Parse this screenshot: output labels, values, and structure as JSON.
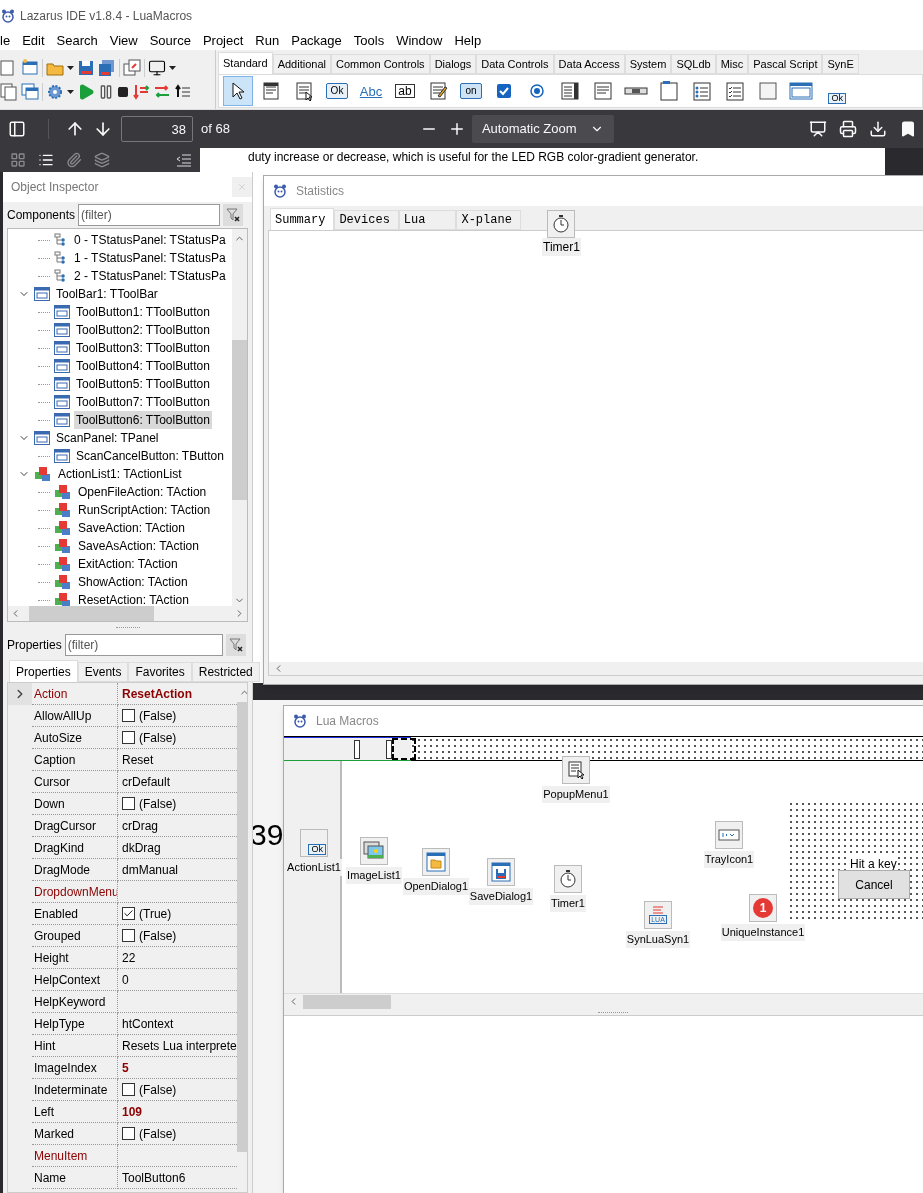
{
  "title_bar": {
    "title": "Lazarus IDE v1.8.4 - LuaMacros"
  },
  "menu": [
    "le",
    "Edit",
    "Search",
    "View",
    "Source",
    "Project",
    "Run",
    "Package",
    "Tools",
    "Window",
    "Help"
  ],
  "palette": {
    "tabs": [
      {
        "label": "Standard",
        "selected": true
      },
      {
        "label": "Additional",
        "selected": false
      },
      {
        "label": "Common Controls",
        "selected": false
      },
      {
        "label": "Dialogs",
        "selected": false
      },
      {
        "label": "Data Controls",
        "selected": false
      },
      {
        "label": "Data Access",
        "selected": false
      },
      {
        "label": "System",
        "selected": false
      },
      {
        "label": "SQLdb",
        "selected": false
      },
      {
        "label": "Misc",
        "selected": false
      },
      {
        "label": "Pascal Script",
        "selected": false
      },
      {
        "label": "SynE",
        "selected": false
      }
    ],
    "icons": [
      {
        "kind": "pointer",
        "selected": true
      },
      {
        "kind": "mainmenu",
        "selected": false
      },
      {
        "kind": "popupmenu",
        "selected": false
      },
      {
        "kind": "button",
        "text": "Ok",
        "selected": false
      },
      {
        "kind": "label",
        "text": "Abc",
        "selected": false
      },
      {
        "kind": "edit",
        "text": "ab",
        "selected": false
      },
      {
        "kind": "memo",
        "selected": false
      },
      {
        "kind": "toggle",
        "text": "on",
        "selected": false
      },
      {
        "kind": "checkbox",
        "selected": false
      },
      {
        "kind": "radio",
        "selected": false
      },
      {
        "kind": "listbox",
        "selected": false
      },
      {
        "kind": "combobox",
        "selected": false
      },
      {
        "kind": "scrollbar",
        "selected": false
      },
      {
        "kind": "groupbox",
        "selected": false
      },
      {
        "kind": "radiogroup",
        "selected": false
      },
      {
        "kind": "checkgroup",
        "selected": false
      },
      {
        "kind": "panel",
        "selected": false
      },
      {
        "kind": "frame",
        "selected": false
      },
      {
        "kind": "actionlist",
        "text": "Ok",
        "selected": false
      }
    ]
  },
  "pdf_viewer": {
    "page": "38",
    "page_count": "of 68",
    "zoom": "Automatic Zoom",
    "sidebar_views": [
      {
        "kind": "thumbnails",
        "selected": false
      },
      {
        "kind": "outline",
        "selected": true
      },
      {
        "kind": "attachments",
        "selected": false
      },
      {
        "kind": "layers",
        "selected": false
      }
    ],
    "page_text": "duty increase or decrease, which is useful for the LED RGB color-gradient generator.",
    "page_number": "39"
  },
  "object_inspector": {
    "title": "Object Inspector",
    "components_label": "Components",
    "components_filter": {
      "placeholder": "(filter)"
    },
    "tree": [
      {
        "children": [
          {
            "label": "0 - TStatusPanel: TStatusPa",
            "kind": "statuspanel",
            "selected": false
          },
          {
            "label": "1 - TStatusPanel: TStatusPa",
            "kind": "statuspanel",
            "selected": false
          },
          {
            "label": "2 - TStatusPanel: TStatusPa",
            "kind": "statuspanel",
            "selected": false
          }
        ]
      },
      {
        "label": "ToolBar1: TToolBar",
        "kind": "form",
        "expanded": true,
        "selected": false,
        "children": [
          {
            "label": "ToolButton1: TToolButton",
            "kind": "form",
            "selected": false
          },
          {
            "label": "ToolButton2: TToolButton",
            "kind": "form",
            "selected": false
          },
          {
            "label": "ToolButton3: TToolButton",
            "kind": "form",
            "selected": false
          },
          {
            "label": "ToolButton4: TToolButton",
            "kind": "form",
            "selected": false
          },
          {
            "label": "ToolButton5: TToolButton",
            "kind": "form",
            "selected": false
          },
          {
            "label": "ToolButton7: TToolButton",
            "kind": "form",
            "selected": false
          },
          {
            "label": "ToolButton6: TToolButton",
            "kind": "form",
            "selected": true
          }
        ]
      },
      {
        "label": "ScanPanel: TPanel",
        "kind": "form",
        "expanded": true,
        "selected": false,
        "children": [
          {
            "label": "ScanCancelButton: TButton",
            "kind": "form",
            "selected": false
          }
        ]
      },
      {
        "label": "ActionList1: TActionList",
        "kind": "action",
        "expanded": true,
        "selected": false,
        "children": [
          {
            "label": "OpenFileAction: TAction",
            "kind": "action",
            "selected": false
          },
          {
            "label": "RunScriptAction: TAction",
            "kind": "action",
            "selected": false
          },
          {
            "label": "SaveAction: TAction",
            "kind": "action",
            "selected": false
          },
          {
            "label": "SaveAsAction: TAction",
            "kind": "action",
            "selected": false
          },
          {
            "label": "ExitAction: TAction",
            "kind": "action",
            "selected": false
          },
          {
            "label": "ShowAction: TAction",
            "kind": "action",
            "selected": false
          },
          {
            "label": "ResetAction: TAction",
            "kind": "action",
            "selected": false
          }
        ]
      }
    ],
    "properties_label": "Properties",
    "properties_filter": {
      "placeholder": "(filter)"
    },
    "tabs": [
      {
        "label": "Properties",
        "selected": true
      },
      {
        "label": "Events",
        "selected": false
      },
      {
        "label": "Favorites",
        "selected": false
      },
      {
        "label": "Restricted",
        "selected": false
      }
    ],
    "properties": [
      {
        "name": "Action",
        "kind": "text",
        "value": "ResetAction",
        "reference": true,
        "modified": true,
        "selected": true
      },
      {
        "name": "AllowAllUp",
        "kind": "checkbox",
        "checked": false,
        "value": "(False)",
        "reference": false,
        "modified": false,
        "selected": false
      },
      {
        "name": "AutoSize",
        "kind": "checkbox",
        "checked": false,
        "value": "(False)",
        "reference": false,
        "modified": false,
        "selected": false
      },
      {
        "name": "Caption",
        "kind": "text",
        "value": "Reset",
        "reference": false,
        "modified": false,
        "selected": false
      },
      {
        "name": "Cursor",
        "kind": "text",
        "value": "crDefault",
        "reference": false,
        "modified": false,
        "selected": false
      },
      {
        "name": "Down",
        "kind": "checkbox",
        "checked": false,
        "value": "(False)",
        "reference": false,
        "modified": false,
        "selected": false
      },
      {
        "name": "DragCursor",
        "kind": "text",
        "value": "crDrag",
        "reference": false,
        "modified": false,
        "selected": false
      },
      {
        "name": "DragKind",
        "kind": "text",
        "value": "dkDrag",
        "reference": false,
        "modified": false,
        "selected": false
      },
      {
        "name": "DragMode",
        "kind": "text",
        "value": "dmManual",
        "reference": false,
        "modified": false,
        "selected": false
      },
      {
        "name": "DropdownMenu",
        "kind": "text",
        "reference": true,
        "selected": false
      },
      {
        "name": "Enabled",
        "kind": "checkbox",
        "checked": true,
        "value": "(True)",
        "reference": false,
        "modified": false,
        "selected": false
      },
      {
        "name": "Grouped",
        "kind": "checkbox",
        "checked": false,
        "value": "(False)",
        "reference": false,
        "modified": false,
        "selected": false
      },
      {
        "name": "Height",
        "kind": "text",
        "value": "22",
        "reference": false,
        "modified": false,
        "selected": false
      },
      {
        "name": "HelpContext",
        "kind": "text",
        "value": "0",
        "reference": false,
        "modified": false,
        "selected": false
      },
      {
        "name": "HelpKeyword",
        "kind": "text",
        "reference": false,
        "selected": false
      },
      {
        "name": "HelpType",
        "kind": "text",
        "value": "htContext",
        "reference": false,
        "modified": false,
        "selected": false
      },
      {
        "name": "Hint",
        "kind": "text",
        "value": "Resets Lua interprete",
        "reference": false,
        "modified": false,
        "selected": false
      },
      {
        "name": "ImageIndex",
        "kind": "text",
        "value": "5",
        "reference": false,
        "modified": true,
        "selected": false
      },
      {
        "name": "Indeterminate",
        "kind": "checkbox",
        "checked": false,
        "value": "(False)",
        "reference": false,
        "modified": false,
        "selected": false
      },
      {
        "name": "Left",
        "kind": "text",
        "value": "109",
        "reference": false,
        "modified": true,
        "selected": false
      },
      {
        "name": "Marked",
        "kind": "checkbox",
        "checked": false,
        "value": "(False)",
        "reference": false,
        "modified": false,
        "selected": false
      },
      {
        "name": "MenuItem",
        "kind": "text",
        "reference": true,
        "selected": false
      },
      {
        "name": "Name",
        "kind": "text",
        "value": "ToolButton6",
        "reference": false,
        "modified": false,
        "selected": false
      }
    ]
  },
  "statistics_window": {
    "title": "Statistics",
    "tabs": [
      {
        "label": "Summary",
        "selected": true
      },
      {
        "label": "Devices",
        "selected": false
      },
      {
        "label": "Lua",
        "selected": false
      },
      {
        "label": "X-plane",
        "selected": false
      }
    ],
    "component": {
      "label": "Timer1",
      "kind": "timer"
    }
  },
  "lua_macros_window": {
    "title": "Lua Macros",
    "components": [
      {
        "label": "PopupMenu1",
        "kind": "popupmenu"
      },
      {
        "label": "ActionList1",
        "kind": "actionlist",
        "icon_text": "Ok"
      },
      {
        "label": "ImageList1",
        "kind": "imagelist"
      },
      {
        "label": "OpenDialog1",
        "kind": "opendialog"
      },
      {
        "label": "SaveDialog1",
        "kind": "savedialog"
      },
      {
        "label": "Timer1",
        "kind": "timer"
      },
      {
        "label": "SynLuaSyn1",
        "kind": "highlighter",
        "icon_text": "LUA"
      },
      {
        "label": "TrayIcon1",
        "kind": "trayicon"
      },
      {
        "label": "UniqueInstance1",
        "kind": "badge",
        "icon_text": "1"
      }
    ],
    "panel": {
      "label": "Hit a key",
      "button": "Cancel"
    }
  }
}
